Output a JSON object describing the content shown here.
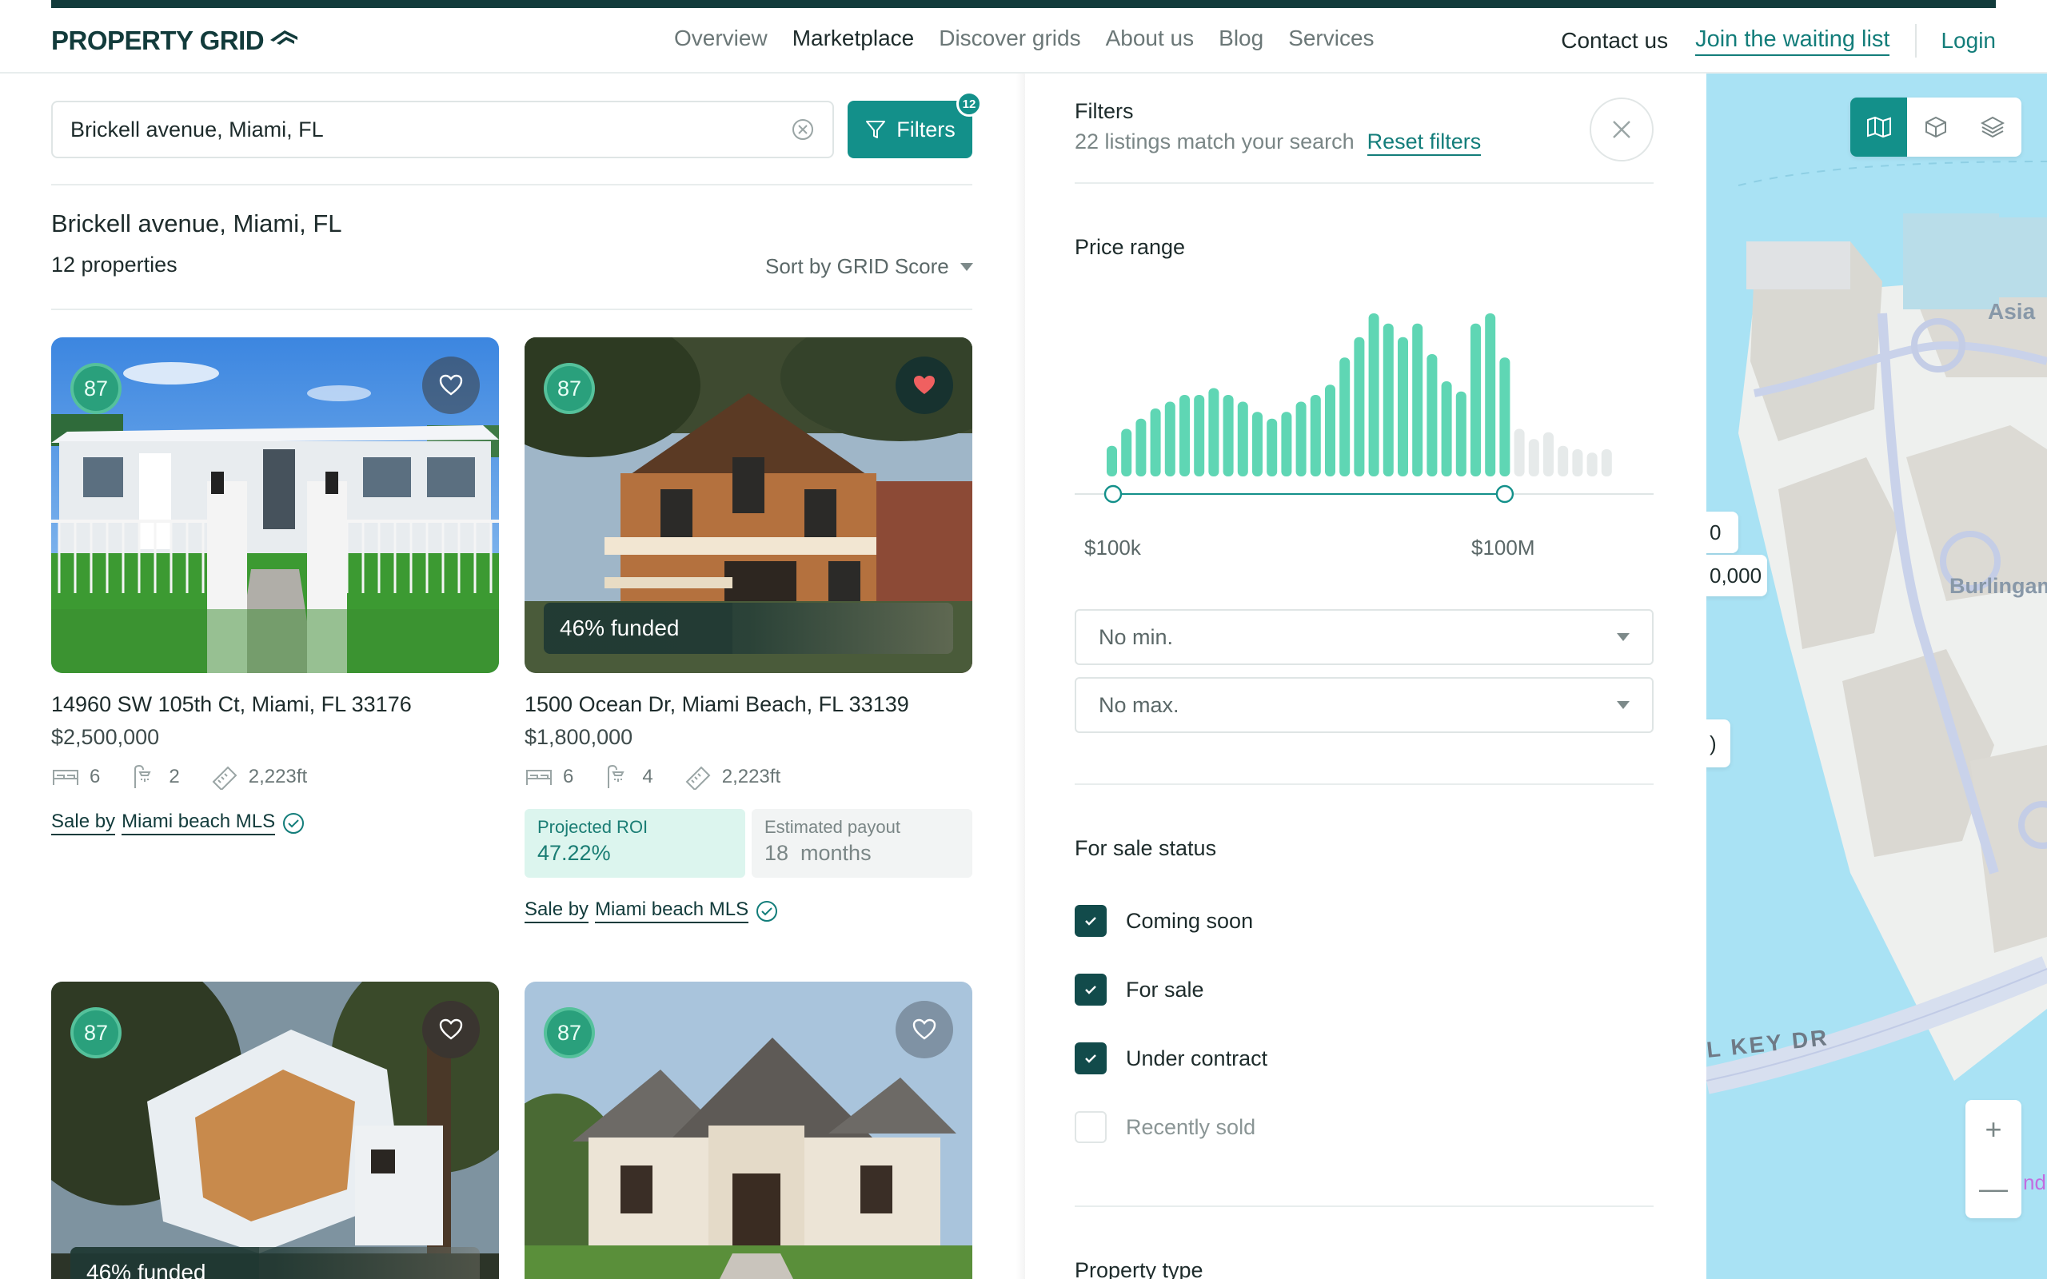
{
  "nav": {
    "logo_text": "PROPERTY GRID",
    "links": [
      "Overview",
      "Marketplace",
      "Discover grids",
      "About us",
      "Blog",
      "Services"
    ],
    "active": "Marketplace",
    "contact": "Contact us",
    "join": "Join the waiting list",
    "login": "Login"
  },
  "search": {
    "value": "Brickell avenue, Miami, FL",
    "filters_label": "Filters",
    "filters_count": "12"
  },
  "results": {
    "title": "Brickell avenue, Miami, FL",
    "count": "12 properties",
    "sort": "Sort by GRID Score"
  },
  "listings": [
    {
      "score": "87",
      "favorited": false,
      "address": "14960 SW 105th Ct, Miami, FL 33176",
      "price": "$2,500,000",
      "beds": "6",
      "baths": "2",
      "area": "2,223ft",
      "sale_prefix": "Sale by",
      "sale_source": "Miami beach MLS"
    },
    {
      "score": "87",
      "favorited": true,
      "funded": "46% funded",
      "funded_fraction": 0.46,
      "address": "1500 Ocean Dr, Miami Beach, FL 33139",
      "price": "$1,800,000",
      "beds": "6",
      "baths": "4",
      "area": "2,223ft",
      "roi_label": "Projected ROI",
      "roi_value": "47.22%",
      "payout_label": "Estimated payout",
      "payout_value": "18  months",
      "sale_prefix": "Sale by",
      "sale_source": "Miami beach MLS"
    },
    {
      "score": "87",
      "favorited": false,
      "funded": "46% funded",
      "funded_fraction": 0.46
    },
    {
      "score": "87",
      "favorited": false
    }
  ],
  "filters": {
    "title": "Filters",
    "match_text": "22 listings match your search",
    "reset": "Reset filters",
    "price_range_title": "Price range",
    "range_min_label": "$100k",
    "range_max_label": "$100M",
    "min_placeholder": "No min.",
    "max_placeholder": "No max.",
    "histogram": [
      18,
      28,
      34,
      40,
      44,
      48,
      48,
      52,
      48,
      44,
      38,
      34,
      38,
      44,
      48,
      54,
      70,
      82,
      96,
      90,
      82,
      90,
      72,
      56,
      50,
      90,
      96,
      70,
      28,
      22,
      26,
      18,
      16,
      14,
      16
    ],
    "selected_bins": 28,
    "sale_status_title": "For sale status",
    "statuses": [
      {
        "label": "Coming soon",
        "checked": true
      },
      {
        "label": "For sale",
        "checked": true
      },
      {
        "label": "Under contract",
        "checked": true
      },
      {
        "label": "Recently sold",
        "checked": false
      }
    ],
    "property_type_title": "Property type"
  },
  "map": {
    "label_asia": "Asia",
    "label_burlingame": "Burlingam",
    "label_road": "L KEY DR",
    "pill_a": "0",
    "pill_b": "0,000",
    "pill_c": ")",
    "zoom_in": "+",
    "zoom_out": "—",
    "edge_text": "nda"
  },
  "colors": {
    "brand": "#123b3b",
    "accent": "#13908a",
    "histogram_active": "#5fd6b4",
    "histogram_inactive": "#e6eaea",
    "map_water": "#a9e2f4"
  }
}
